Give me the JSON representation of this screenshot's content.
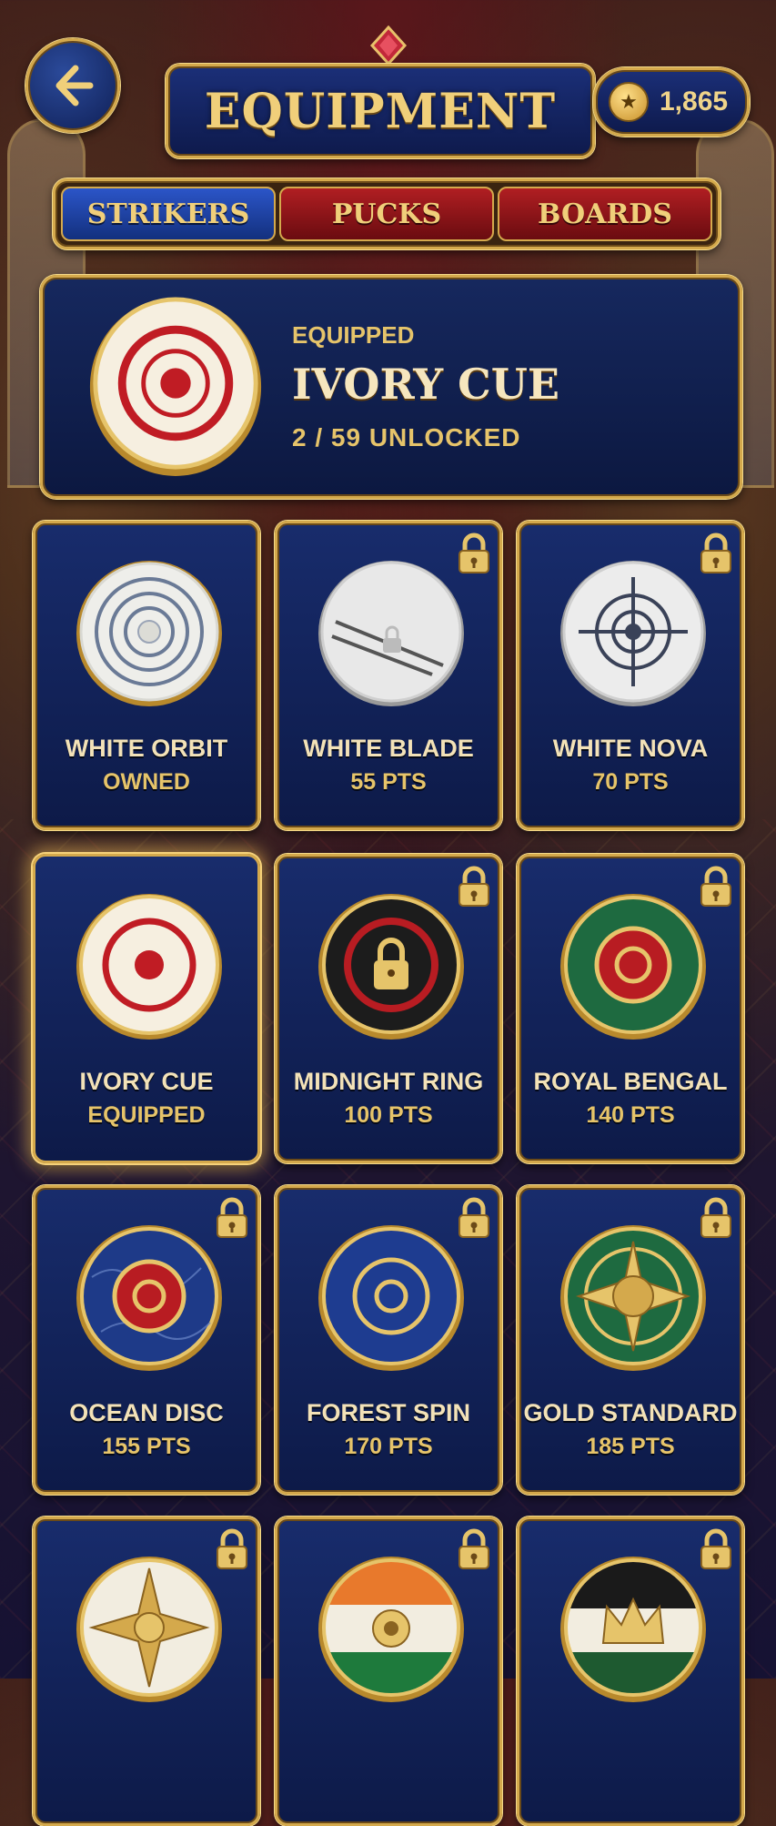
{
  "header": {
    "title": "EQUIPMENT",
    "coins": "1,865"
  },
  "tabs": [
    {
      "label": "STRIKERS",
      "active": true
    },
    {
      "label": "PUCKS",
      "active": false
    },
    {
      "label": "BOARDS",
      "active": false
    }
  ],
  "equipped": {
    "label": "EQUIPPED",
    "name": "IVORY CUE",
    "progress": "2 / 59 UNLOCKED"
  },
  "items": [
    {
      "name": "WHITE ORBIT",
      "status": "OWNED",
      "locked": false,
      "style": "white-orbit"
    },
    {
      "name": "WHITE BLADE",
      "status": "55 PTS",
      "locked": true,
      "style": "white-blade"
    },
    {
      "name": "WHITE NOVA",
      "status": "70 PTS",
      "locked": true,
      "style": "white-nova"
    },
    {
      "name": "IVORY CUE",
      "status": "EQUIPPED",
      "locked": false,
      "style": "ivory-cue"
    },
    {
      "name": "MIDNIGHT RING",
      "status": "100 PTS",
      "locked": true,
      "style": "midnight-ring"
    },
    {
      "name": "ROYAL BENGAL",
      "status": "140 PTS",
      "locked": true,
      "style": "royal-bengal"
    },
    {
      "name": "OCEAN DISC",
      "status": "155 PTS",
      "locked": true,
      "style": "ocean-disc"
    },
    {
      "name": "FOREST SPIN",
      "status": "170 PTS",
      "locked": true,
      "style": "forest-spin"
    },
    {
      "name": "GOLD STANDARD",
      "status": "185 PTS",
      "locked": true,
      "style": "gold-standard"
    },
    {
      "name": "",
      "status": "",
      "locked": true,
      "style": "gold-star"
    },
    {
      "name": "",
      "status": "",
      "locked": true,
      "style": "tricolor"
    },
    {
      "name": "",
      "status": "",
      "locked": true,
      "style": "crown"
    }
  ],
  "colors": {
    "gold": "#d4a94c",
    "navy": "#13307e",
    "red": "#b01e22"
  }
}
